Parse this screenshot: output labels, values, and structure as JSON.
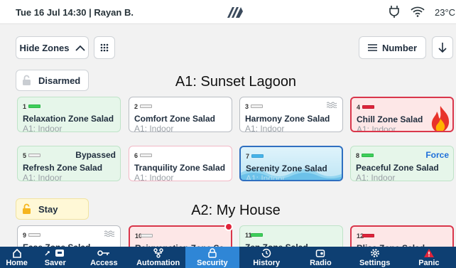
{
  "status": {
    "datetime_user": "Tue 16 Jul 14:30 | Rayan B.",
    "temp": "23°C"
  },
  "toolbar": {
    "hide_zones": "Hide Zones",
    "sort": "Number"
  },
  "areas": [
    {
      "title": "A1: Sunset Lagoon",
      "state": "Disarmed"
    },
    {
      "title": "A2: My House",
      "state": "Stay"
    }
  ],
  "zones": [
    {
      "num": "1",
      "name": "Relaxation Zone Salad",
      "loc": "A1: Indoor",
      "tag": ""
    },
    {
      "num": "2",
      "name": "Comfort Zone Salad",
      "loc": "A1: Indoor",
      "tag": ""
    },
    {
      "num": "3",
      "name": "Harmony Zone Salad",
      "loc": "A1: Indoor",
      "tag": ""
    },
    {
      "num": "4",
      "name": "Chill Zone Salad",
      "loc": "A1: Indoor",
      "tag": ""
    },
    {
      "num": "5",
      "name": "Refresh Zone Salad",
      "loc": "A1: Indoor",
      "tag": "Bypassed"
    },
    {
      "num": "6",
      "name": "Tranquility Zone Salad",
      "loc": "A1: Indoor",
      "tag": ""
    },
    {
      "num": "7",
      "name": "Serenity Zone Salad",
      "loc": "A1: Indoor",
      "tag": ""
    },
    {
      "num": "8",
      "name": "Peaceful Zone Salad",
      "loc": "A1: Indoor",
      "tag": "Force"
    },
    {
      "num": "9",
      "name": "Ease Zone Salad",
      "loc": "",
      "tag": ""
    },
    {
      "num": "10",
      "name": "Rejuvenation Zone Sa",
      "loc": "",
      "tag": ""
    },
    {
      "num": "11",
      "name": "Zen Zone Salad",
      "loc": "",
      "tag": ""
    },
    {
      "num": "12",
      "name": "Bliss Zone Salad",
      "loc": "",
      "tag": ""
    }
  ],
  "nav": [
    {
      "label": "Home"
    },
    {
      "label": "Saver"
    },
    {
      "label": "Access"
    },
    {
      "label": "Automation"
    },
    {
      "label": "Security"
    },
    {
      "label": "History"
    },
    {
      "label": "Radio"
    },
    {
      "label": "Settings"
    },
    {
      "label": "Panic"
    }
  ],
  "colors": {
    "accent": "#2f86d6",
    "nav_bg": "#0e3f72",
    "alarm": "#d9364b",
    "ok": "#3ecf5a",
    "force": "#1e6fd9"
  }
}
